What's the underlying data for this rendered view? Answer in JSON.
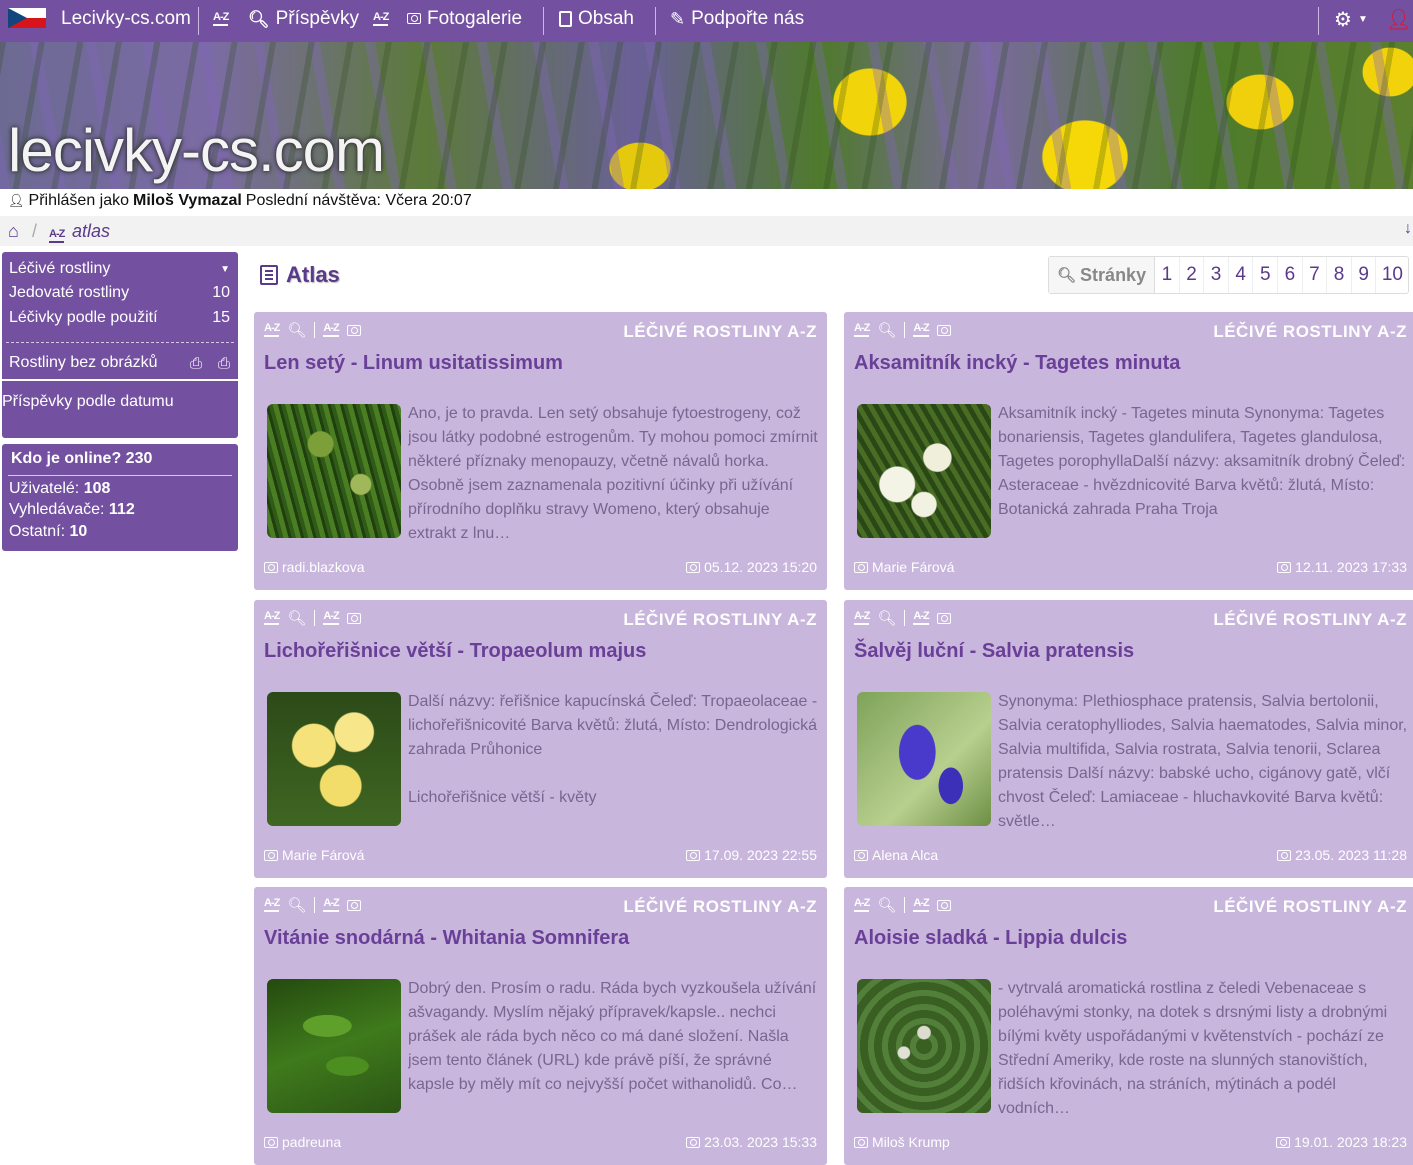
{
  "nav": {
    "brand": "Lecivky-cs.com",
    "items": [
      {
        "label": "Příspěvky"
      },
      {
        "label": "Fotogalerie"
      },
      {
        "label": "Obsah"
      },
      {
        "label": "Podpořte nás"
      }
    ],
    "color": "#7451a0"
  },
  "banner": {
    "logo_text": "lecivky-cs.com"
  },
  "user": {
    "prefix": "Přihlášen jako",
    "name": "Miloš Vymazal",
    "last_visit": "Poslední návštěva: Včera 20:07"
  },
  "breadcrumb": {
    "current": "atlas"
  },
  "sidebar": {
    "menu": [
      {
        "label": "Léčivé rostliny",
        "count": ""
      },
      {
        "label": "Jedovaté rostliny",
        "count": "10"
      },
      {
        "label": "Léčivky podle použití",
        "count": "15"
      },
      {
        "label": "Rostliny bez obrázků",
        "count": ""
      },
      {
        "label": "Příspěvky podle datumu",
        "count": ""
      }
    ],
    "online": {
      "title": "Kdo je online? 230",
      "users_label": "Uživatelé:",
      "users": "108",
      "bots_label": "Vyhledávače:",
      "bots": "112",
      "other_label": "Ostatní:",
      "other": "10"
    }
  },
  "content": {
    "title": "Atlas",
    "pager": {
      "label": "Stránky",
      "pages": [
        "1",
        "2",
        "3",
        "4",
        "5",
        "6",
        "7",
        "8",
        "9",
        "10"
      ]
    },
    "category_label": "LÉČIVÉ ROSTLINY A-Z",
    "cards": [
      {
        "title": "Len setý - Linum usitatissimum",
        "text": "Ano, je to pravda. Len setý obsahuje fytoestrogeny, což jsou látky podobné estrogenům. Ty mohou pomoci zmírnit některé příznaky menopauzy, včetně návalů horka. Osobně jsem zaznamenala pozitivní účinky při užívání přírodního doplňku stravy Womeno, který obsahuje extrakt z lnu…",
        "author": "radi.blazkova",
        "date": "05.12. 2023 15:20"
      },
      {
        "title": "Aksamitník incký - Tagetes minuta",
        "text": "Aksamitník incký - Tagetes minuta Synonyma: Tagetes bonariensis, Tagetes glandulifera, Tagetes glandulosa, Tagetes porophyllaDalší názvy: aksamitník drobný Čeleď: Asteraceae - hvězdnicovité Barva květů: žlutá, Místo: Botanická zahrada Praha Troja",
        "author": "Marie Fárová",
        "date": "12.11. 2023 17:33"
      },
      {
        "title": "Lichořeřišnice větší - Tropaeolum majus",
        "text": "Další názvy: řeřišnice kapucínská Čeleď: Tropaeolaceae - lichořeřišnicovité Barva květů: žlutá, Místo: Dendrologická zahrada Průhonice",
        "text2": "Lichořeřišnice větší - květy",
        "author": "Marie Fárová",
        "date": "17.09. 2023 22:55"
      },
      {
        "title": "Šalvěj luční - Salvia pratensis",
        "text": "Synonyma: Plethiosphace pratensis, Salvia bertolonii, Salvia ceratophylliodes, Salvia haematodes, Salvia minor, Salvia multifida, Salvia rostrata, Salvia tenorii, Sclarea pratensis Další názvy: babské ucho, cigánovy gatě, vlčí chvost Čeleď: Lamiaceae - hluchavkovité Barva květů: světle…",
        "author": "Alena Alca",
        "date": "23.05. 2023 11:28"
      },
      {
        "title": "Vitánie snodárná - Whitania Somnifera",
        "text": "Dobrý den. Prosím o radu. Ráda bych vyzkoušela užívání ašvagandy. Myslím nějaký přípravek/kapsle.. nechci prášek ale ráda bych něco co má dané složení. Našla jsem tento článek (URL) kde právě píší, že správné kapsle by měly mít co nejvyšší počet withanolidů. Co…",
        "author": "padreuna",
        "date": "23.03. 2023 15:33"
      },
      {
        "title": "Aloisie sladká - Lippia dulcis",
        "text": "- vytrvalá aromatická rostlina z čeledi Vebenaceae s poléhavými stonky, na dotek s drsnými listy a drobnými bílými květy uspořádanými v květenstvích - pochází ze Střední Ameriky, kde roste na slunných stanovištích, řidších křovinách, na stráních, mýtinách a podél vodních…",
        "author": "Miloš Krump",
        "date": "19.01. 2023 18:23"
      }
    ]
  }
}
